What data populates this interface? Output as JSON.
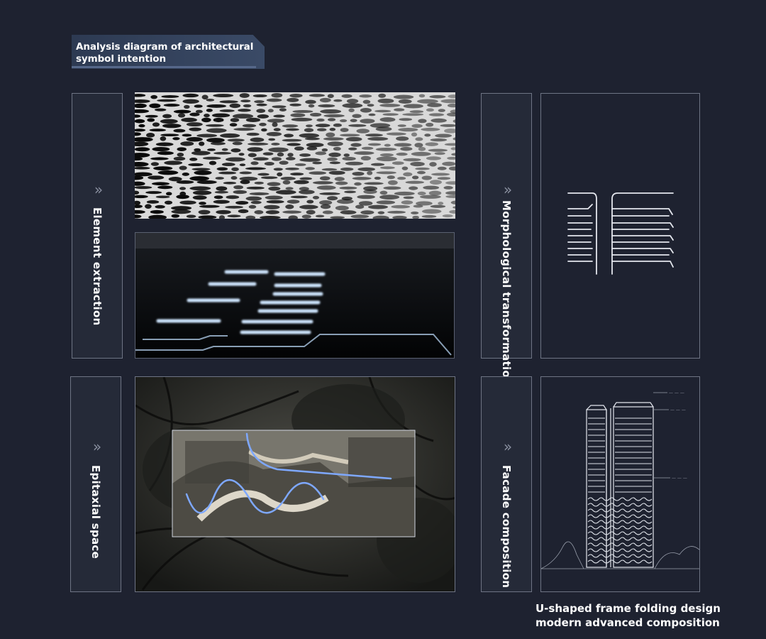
{
  "header": {
    "title": "Analysis diagram of architectural symbol intention"
  },
  "panels": [
    {
      "label": "Element extraction",
      "chevron": "»"
    },
    {
      "label": "Morphological transformation",
      "chevron": "»"
    },
    {
      "label": "Epitaxial space",
      "chevron": "»"
    },
    {
      "label": "Facade composition",
      "chevron": "»"
    }
  ],
  "images": {
    "water": "water-ripple-photo",
    "light_strips": "light-strips-render",
    "pavilion": "chinese-pavilion-roof-photo",
    "fold_sketch": "u-frame-folding-sketch",
    "facade_sketch": "tower-facade-sketch"
  },
  "footer": {
    "caption": "U-shaped frame folding design modern advanced composition"
  },
  "colors": {
    "background": "#1e2230",
    "panel_border": "#6e7484",
    "accent": "#4f7fd6"
  }
}
